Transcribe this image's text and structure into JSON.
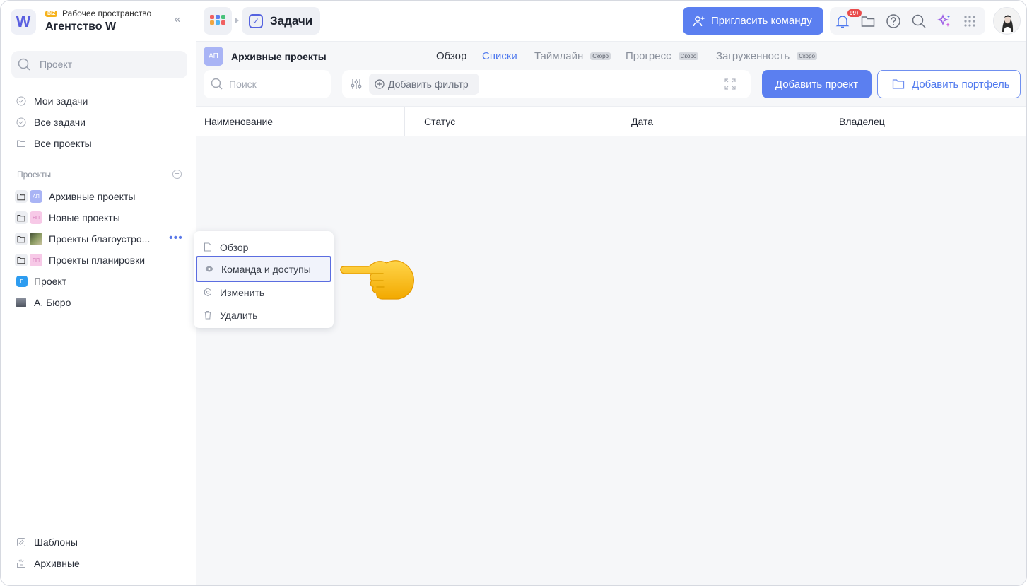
{
  "workspace": {
    "badge": "BIZ",
    "subtitle": "Рабочее пространство",
    "name": "Агентство W",
    "logo": "W"
  },
  "sidebar": {
    "search_placeholder": "Проект",
    "nav": [
      {
        "label": "Мои задачи",
        "icon": "check-circle-icon"
      },
      {
        "label": "Все задачи",
        "icon": "check-circle-icon"
      },
      {
        "label": "Все проекты",
        "icon": "folder-icon"
      }
    ],
    "section_title": "Проекты",
    "projects": [
      {
        "abbr": "АП",
        "label": "Архивные проекты",
        "color": "#a9b4f5"
      },
      {
        "abbr": "НП",
        "label": "Новые проекты",
        "color": "#f7c9e7"
      },
      {
        "abbr": "",
        "label": "Проекты благоустро...",
        "color": "#6b7a55"
      },
      {
        "abbr": "ПП",
        "label": "Проекты планировки",
        "color": "#f7c9e7"
      }
    ],
    "other": [
      {
        "abbr": "П",
        "label": "Проект",
        "color": "#2d9cf0"
      },
      {
        "abbr": "",
        "label": "А. Бюро",
        "color": "#5b6170"
      }
    ],
    "bottom": [
      {
        "label": "Шаблоны",
        "icon": "templates-icon"
      },
      {
        "label": "Архивные",
        "icon": "archive-icon"
      }
    ]
  },
  "topbar": {
    "breadcrumb": "Задачи",
    "invite_label": "Пригласить команду",
    "notif_count": "99+"
  },
  "subheader": {
    "project_abbr": "АП",
    "project_title": "Архивные проекты",
    "tabs": [
      {
        "label": "Обзор",
        "soon": ""
      },
      {
        "label": "Списки",
        "soon": ""
      },
      {
        "label": "Таймлайн",
        "soon": "Скоро"
      },
      {
        "label": "Прогресс",
        "soon": "Скоро"
      },
      {
        "label": "Загруженность",
        "soon": "Скоро"
      }
    ],
    "search_placeholder": "Поиск",
    "add_filter": "Добавить фильтр",
    "add_project": "Добавить проект",
    "add_portfolio": "Добавить портфель"
  },
  "table": {
    "columns": [
      "Наименование",
      "Статус",
      "Дата",
      "Владелец"
    ]
  },
  "context_menu": {
    "items": [
      {
        "label": "Обзор",
        "icon": "document-icon"
      },
      {
        "label": "Команда и доступы",
        "icon": "eye-icon"
      },
      {
        "label": "Изменить",
        "icon": "settings-icon"
      },
      {
        "label": "Удалить",
        "icon": "trash-icon"
      }
    ]
  },
  "colors": {
    "accent": "#5b7ff0",
    "active_tab": "#4e78ee",
    "notif": "#e94b4b"
  }
}
